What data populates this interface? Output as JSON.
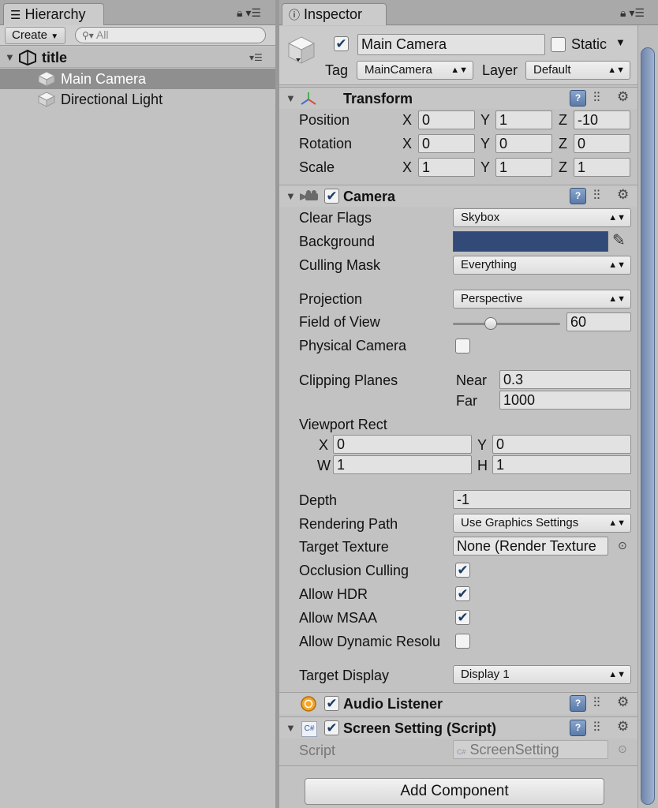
{
  "hierarchy": {
    "tab_title": "Hierarchy",
    "create_label": "Create",
    "search_placeholder": "All",
    "scene_name": "title",
    "items": [
      {
        "label": "Main Camera",
        "selected": true
      },
      {
        "label": "Directional Light",
        "selected": false
      }
    ]
  },
  "inspector": {
    "tab_title": "Inspector",
    "object": {
      "name": "Main Camera",
      "active": true,
      "static_label": "Static",
      "tag_label": "Tag",
      "tag_value": "MainCamera",
      "layer_label": "Layer",
      "layer_value": "Default"
    },
    "transform": {
      "title": "Transform",
      "rows": [
        {
          "label": "Position",
          "x": "0",
          "y": "1",
          "z": "-10"
        },
        {
          "label": "Rotation",
          "x": "0",
          "y": "0",
          "z": "0"
        },
        {
          "label": "Scale",
          "x": "1",
          "y": "1",
          "z": "1"
        }
      ],
      "axis_x": "X",
      "axis_y": "Y",
      "axis_z": "Z"
    },
    "camera": {
      "title": "Camera",
      "enabled": true,
      "clear_flags_label": "Clear Flags",
      "clear_flags_value": "Skybox",
      "background_label": "Background",
      "background_color": "#314a77",
      "culling_mask_label": "Culling Mask",
      "culling_mask_value": "Everything",
      "projection_label": "Projection",
      "projection_value": "Perspective",
      "fov_label": "Field of View",
      "fov_value": "60",
      "fov_fraction": 0.35,
      "physical_label": "Physical Camera",
      "physical_checked": false,
      "clipping_label": "Clipping Planes",
      "near_label": "Near",
      "near_value": "0.3",
      "far_label": "Far",
      "far_value": "1000",
      "viewport_label": "Viewport Rect",
      "vp_x_label": "X",
      "vp_x": "0",
      "vp_y_label": "Y",
      "vp_y": "0",
      "vp_w_label": "W",
      "vp_w": "1",
      "vp_h_label": "H",
      "vp_h": "1",
      "depth_label": "Depth",
      "depth_value": "-1",
      "rendering_path_label": "Rendering Path",
      "rendering_path_value": "Use Graphics Settings",
      "target_texture_label": "Target Texture",
      "target_texture_value": "None (Render Texture",
      "occlusion_label": "Occlusion Culling",
      "hdr_label": "Allow HDR",
      "msaa_label": "Allow MSAA",
      "dynres_label": "Allow Dynamic Resolu",
      "target_display_label": "Target Display",
      "target_display_value": "Display 1"
    },
    "audio_listener": {
      "title": "Audio Listener",
      "enabled": true
    },
    "screen_setting": {
      "title": "Screen Setting (Script)",
      "enabled": true,
      "script_label": "Script",
      "script_value": "ScreenSetting"
    },
    "add_component_label": "Add Component",
    "check_glyph": "✔"
  }
}
